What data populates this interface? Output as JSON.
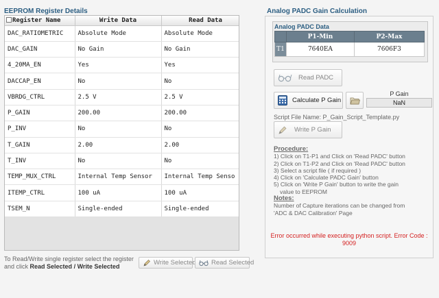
{
  "eeprom": {
    "title": "EEPROM Register Details",
    "columns": [
      "Register Name",
      "Write Data",
      "Read Data"
    ],
    "rows": [
      {
        "name": "DAC_RATIOMETRIC",
        "write": "Absolute Mode",
        "read": "Absolute Mode"
      },
      {
        "name": "DAC_GAIN",
        "write": "No Gain",
        "read": "No Gain"
      },
      {
        "name": "4_20MA_EN",
        "write": "Yes",
        "read": "Yes"
      },
      {
        "name": "DACCAP_EN",
        "write": "No",
        "read": "No"
      },
      {
        "name": "VBRDG_CTRL",
        "write": "2.5 V",
        "read": "2.5 V"
      },
      {
        "name": "P_GAIN",
        "write": "200.00",
        "read": "200.00"
      },
      {
        "name": "P_INV",
        "write": "No",
        "read": "No"
      },
      {
        "name": "T_GAIN",
        "write": "2.00",
        "read": "2.00"
      },
      {
        "name": "T_INV",
        "write": "No",
        "read": "No"
      },
      {
        "name": "TEMP_MUX_CTRL",
        "write": "Internal Temp Sensor",
        "read": "Internal Temp Senso"
      },
      {
        "name": "ITEMP_CTRL",
        "write": "100 uA",
        "read": "100 uA"
      },
      {
        "name": "TSEM_N",
        "write": "Single-ended",
        "read": "Single-ended"
      }
    ],
    "hint_line1": "To Read/Write single register select the register",
    "hint_line2_prefix": "and click ",
    "hint_read_selected": "Read Selected",
    "hint_sep": " / ",
    "hint_write_selected": "Write Selected",
    "write_selected_label": "Write Selected",
    "read_selected_label": "Read Selected"
  },
  "padc": {
    "title": "Analog PADC Gain Calculation",
    "sub_title": "Analog PADC Data",
    "columns": [
      "P1-Min",
      "P2-Max"
    ],
    "row_label": "T1",
    "p1_min": "7640EA",
    "p2_max": "7606F3",
    "read_padc_label": "Read PADC",
    "calc_label": "Calculate P Gain",
    "p_gain_label": "P Gain",
    "p_gain_value": "NaN",
    "script_file": "Script File Name:  P_Gain_Script_Template.py",
    "write_p_gain_label": "Write P Gain"
  },
  "procedure": {
    "heading": "Procedure:",
    "steps": [
      "1) Click on T1-P1 and  Click on 'Read PADC' button",
      "2) Click on T1-P2 and Click on 'Read PADC' button",
      "3) Select a script file ( if required )",
      "4) Click on 'Calculate PADC Gain' button",
      "5) Click on 'Write P Gain' button to write the gain",
      "value to EEPROM"
    ],
    "notes_heading": "Notes:",
    "notes_line1": "Number of Capture iterations can be changed from",
    "notes_line2": "'ADC & DAC Calibration' Page"
  },
  "error": {
    "line1": "Error occurred while executing python script. Error Code :",
    "line2": "9009"
  },
  "colors": {
    "title_blue": "#2c5e82",
    "table_header": "#6b7f8e",
    "error_red": "#d42020"
  }
}
